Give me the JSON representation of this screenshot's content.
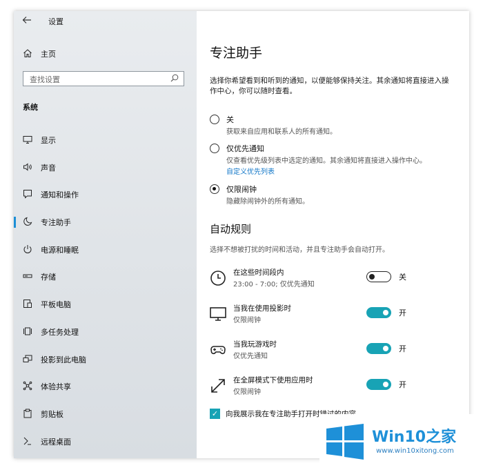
{
  "sidebar": {
    "back_icon": "back-arrow-icon",
    "title": "设置",
    "home_label": "主页",
    "search_placeholder": "查找设置",
    "section": "系统",
    "items": [
      {
        "label": "显示",
        "icon": "display-icon"
      },
      {
        "label": "声音",
        "icon": "speaker-icon"
      },
      {
        "label": "通知和操作",
        "icon": "notification-icon"
      },
      {
        "label": "专注助手",
        "icon": "moon-icon",
        "active": true
      },
      {
        "label": "电源和睡眠",
        "icon": "power-icon"
      },
      {
        "label": "存储",
        "icon": "storage-icon"
      },
      {
        "label": "平板电脑",
        "icon": "tablet-icon"
      },
      {
        "label": "多任务处理",
        "icon": "multitask-icon"
      },
      {
        "label": "投影到此电脑",
        "icon": "project-icon"
      },
      {
        "label": "体验共享",
        "icon": "share-icon"
      },
      {
        "label": "剪贴板",
        "icon": "clipboard-icon"
      },
      {
        "label": "远程桌面",
        "icon": "remote-desktop-icon"
      }
    ]
  },
  "main": {
    "title": "专注助手",
    "description": "选择你希望看到和听到的通知，以便能够保持关注。其余通知将直接进入操作中心，你可以随时查看。",
    "options": [
      {
        "label": "关",
        "sub": "获取来自应用和联系人的所有通知。",
        "checked": false
      },
      {
        "label": "仅优先通知",
        "sub": "仅查看优先级列表中选定的通知。其余通知将直接进入操作中心。",
        "link": "自定义优先列表",
        "checked": false
      },
      {
        "label": "仅限闹钟",
        "sub": "隐藏除闹钟外的所有通知。",
        "checked": true
      }
    ],
    "auto_rules_heading": "自动规则",
    "auto_rules_desc": "选择不想被打扰的时间和活动，并且专注助手会自动打开。",
    "rules": [
      {
        "title": "在这些时间段内",
        "sub": "23:00 - 7:00; 仅优先通知",
        "state": "关",
        "on": false,
        "icon": "clock-icon"
      },
      {
        "title": "当我在使用投影时",
        "sub": "仅限闹钟",
        "state": "开",
        "on": true,
        "icon": "monitor-icon"
      },
      {
        "title": "当我玩游戏时",
        "sub": "仅优先通知",
        "state": "开",
        "on": true,
        "icon": "gamepad-icon"
      },
      {
        "title": "在全屏模式下使用应用时",
        "sub": "仅限闹钟",
        "state": "开",
        "on": true,
        "icon": "fullscreen-icon"
      }
    ],
    "checkbox_label": "向我展示我在专注助手打开时错过的内容",
    "accent_color": "#18a3b5"
  },
  "watermark": {
    "title": "Win10之家",
    "url": "www.win10xitong.com",
    "brand_color": "#1e90d8"
  }
}
